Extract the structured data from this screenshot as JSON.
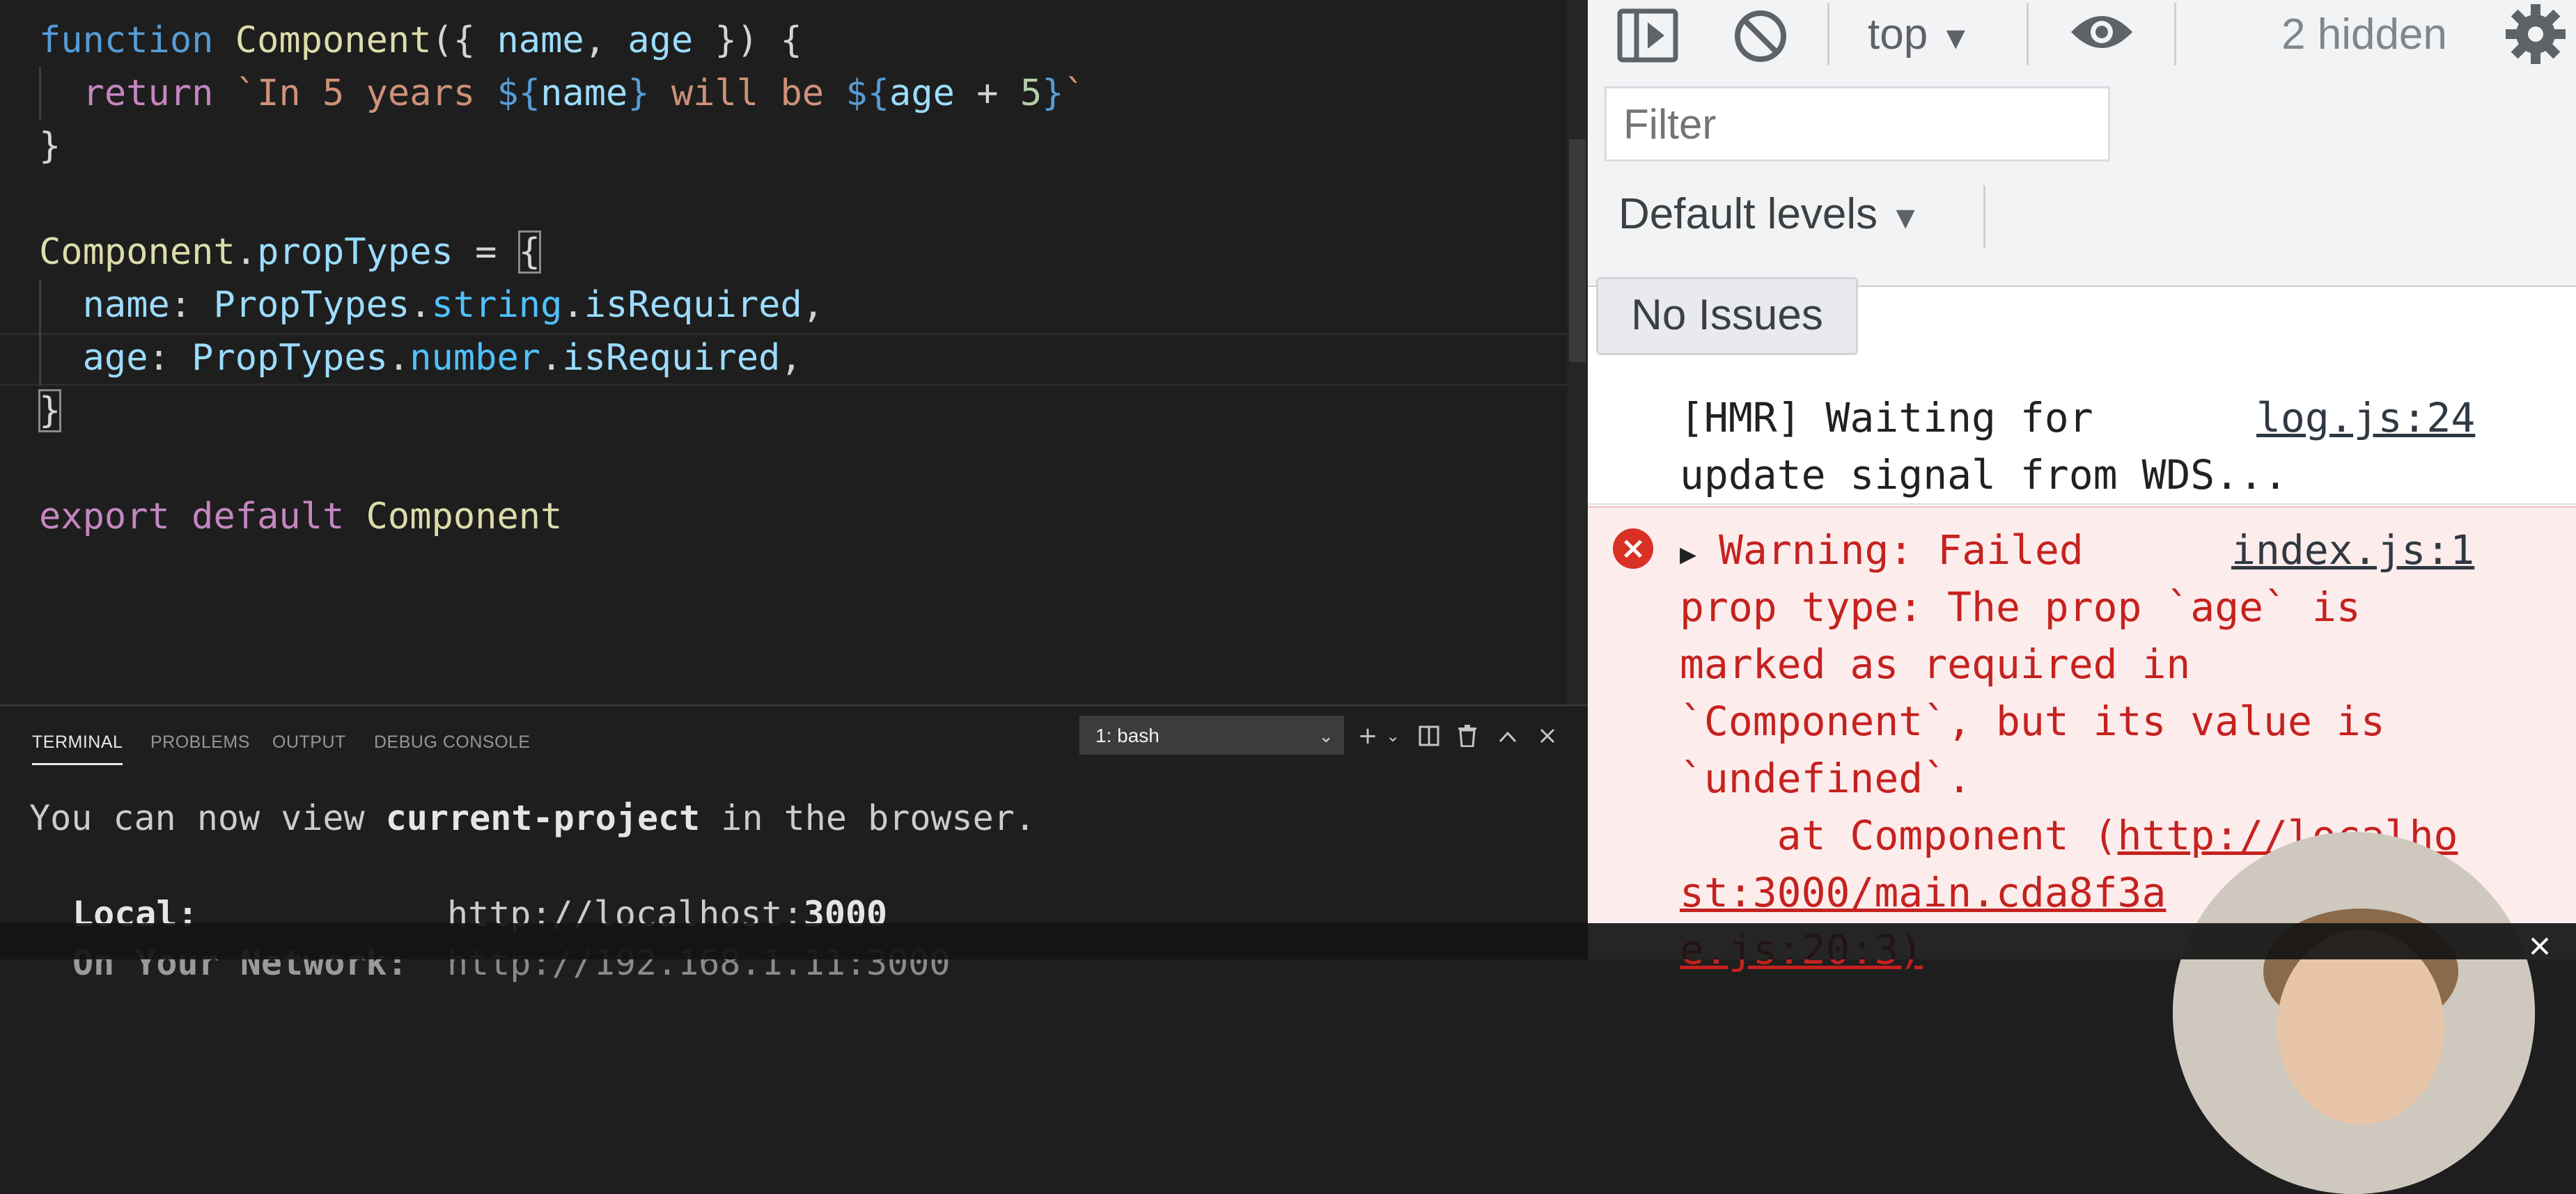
{
  "editor": {
    "lines": [
      {
        "tokens": [
          {
            "t": "function",
            "c": "kw2"
          },
          {
            "t": " ",
            "c": ""
          },
          {
            "t": "Component",
            "c": "fn"
          },
          {
            "t": "({ ",
            "c": ""
          },
          {
            "t": "name",
            "c": "var"
          },
          {
            "t": ", ",
            "c": ""
          },
          {
            "t": "age",
            "c": "var"
          },
          {
            "t": " }) {",
            "c": ""
          }
        ]
      },
      {
        "tokens": [
          {
            "t": "  ",
            "c": ""
          },
          {
            "t": "return",
            "c": "kw"
          },
          {
            "t": " `In 5 years ",
            "c": "str"
          },
          {
            "t": "${",
            "c": "tpl"
          },
          {
            "t": "name",
            "c": "var"
          },
          {
            "t": "}",
            "c": "tpl"
          },
          {
            "t": " will be ",
            "c": "str"
          },
          {
            "t": "${",
            "c": "tpl"
          },
          {
            "t": "age",
            "c": "var"
          },
          {
            "t": " + ",
            "c": ""
          },
          {
            "t": "5",
            "c": "num"
          },
          {
            "t": "}",
            "c": "tpl"
          },
          {
            "t": "`",
            "c": "str"
          }
        ]
      },
      {
        "tokens": [
          {
            "t": "}",
            "c": ""
          }
        ]
      },
      {
        "tokens": []
      },
      {
        "tokens": [
          {
            "t": "Component",
            "c": "fn"
          },
          {
            "t": ".",
            "c": ""
          },
          {
            "t": "propTypes",
            "c": "var"
          },
          {
            "t": " = ",
            "c": ""
          },
          {
            "t": "{",
            "c": "bracket"
          }
        ]
      },
      {
        "tokens": [
          {
            "t": "  ",
            "c": ""
          },
          {
            "t": "name",
            "c": "var"
          },
          {
            "t": ": ",
            "c": ""
          },
          {
            "t": "PropTypes",
            "c": "var"
          },
          {
            "t": ".",
            "c": ""
          },
          {
            "t": "string",
            "c": "prop"
          },
          {
            "t": ".",
            "c": ""
          },
          {
            "t": "isRequired",
            "c": "var"
          },
          {
            "t": ",",
            "c": ""
          }
        ]
      },
      {
        "tokens": [
          {
            "t": "  ",
            "c": ""
          },
          {
            "t": "age",
            "c": "var"
          },
          {
            "t": ": ",
            "c": ""
          },
          {
            "t": "PropTypes",
            "c": "var"
          },
          {
            "t": ".",
            "c": ""
          },
          {
            "t": "number",
            "c": "prop"
          },
          {
            "t": ".",
            "c": ""
          },
          {
            "t": "isRequired",
            "c": "var"
          },
          {
            "t": ",",
            "c": ""
          }
        ]
      },
      {
        "tokens": [
          {
            "t": "}",
            "c": "bracket"
          }
        ]
      },
      {
        "tokens": []
      },
      {
        "tokens": [
          {
            "t": "export",
            "c": "kw"
          },
          {
            "t": " ",
            "c": ""
          },
          {
            "t": "default",
            "c": "kw"
          },
          {
            "t": " ",
            "c": ""
          },
          {
            "t": "Component",
            "c": "fn"
          }
        ]
      }
    ]
  },
  "panel": {
    "tabs": [
      "TERMINAL",
      "PROBLEMS",
      "OUTPUT",
      "DEBUG CONSOLE"
    ],
    "active_tab": "TERMINAL",
    "terminal_select": "1: bash",
    "output": {
      "line1_pre": "You can now view ",
      "line1_bold": "current-project",
      "line1_post": " in the browser.",
      "local_label": "Local:",
      "local_url_pre": "http://localhost:",
      "local_url_port": "3000",
      "network_label": "On Your Network:",
      "network_url": "http://192.168.1.11:3000"
    }
  },
  "devtools": {
    "context": "top",
    "hidden_count": "2 hidden",
    "filter_placeholder": "Filter",
    "levels": "Default levels",
    "issues": "No Issues",
    "logs": [
      {
        "type": "info",
        "message": "[HMR] Waiting for\nupdate signal from WDS...",
        "source": "log.js:24"
      },
      {
        "type": "error",
        "message": "Warning: Failed\nprop type: The prop `age` is\nmarked as required in\n`Component`, but its value is\n`undefined`.",
        "at_prefix": "    at Component (",
        "link_part1": "http://localho",
        "link_part2": "st:3000/main.cda8f3a",
        "link_tail": "e.js:20:3)",
        "source": "index.js:1"
      }
    ]
  }
}
